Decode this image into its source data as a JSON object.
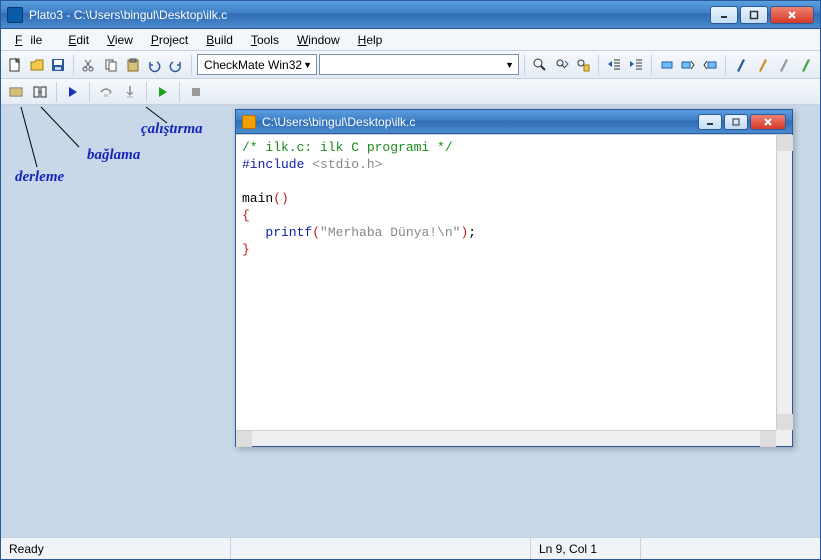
{
  "window": {
    "title": "Plato3 - C:\\Users\\bingul\\Desktop\\ilk.c"
  },
  "menu": {
    "file": "File",
    "edit": "Edit",
    "view": "View",
    "project": "Project",
    "build": "Build",
    "tools": "Tools",
    "window": "Window",
    "help": "Help"
  },
  "toolbar": {
    "target_combo": "CheckMate Win32"
  },
  "annotations": {
    "compile": "derleme",
    "link": "bağlama",
    "run": "çalıştırma"
  },
  "child": {
    "title": "C:\\Users\\bingul\\Desktop\\ilk.c",
    "code": {
      "l1_comment": "/* ilk.c: ilk C programi */",
      "l2_pp": "#include",
      "l2_ang": "<stdio.h>",
      "l4_main": "main",
      "l4_parens": "()",
      "l5_brace_open": "{",
      "l6_indent": "   ",
      "l6_fn": "printf",
      "l6_po": "(",
      "l6_str": "\"Merhaba Dünya!\\n\"",
      "l6_pc": ")",
      "l6_semi": ";",
      "l7_brace_close": "}"
    }
  },
  "status": {
    "ready": "Ready",
    "pos": "Ln 9, Col 1"
  }
}
